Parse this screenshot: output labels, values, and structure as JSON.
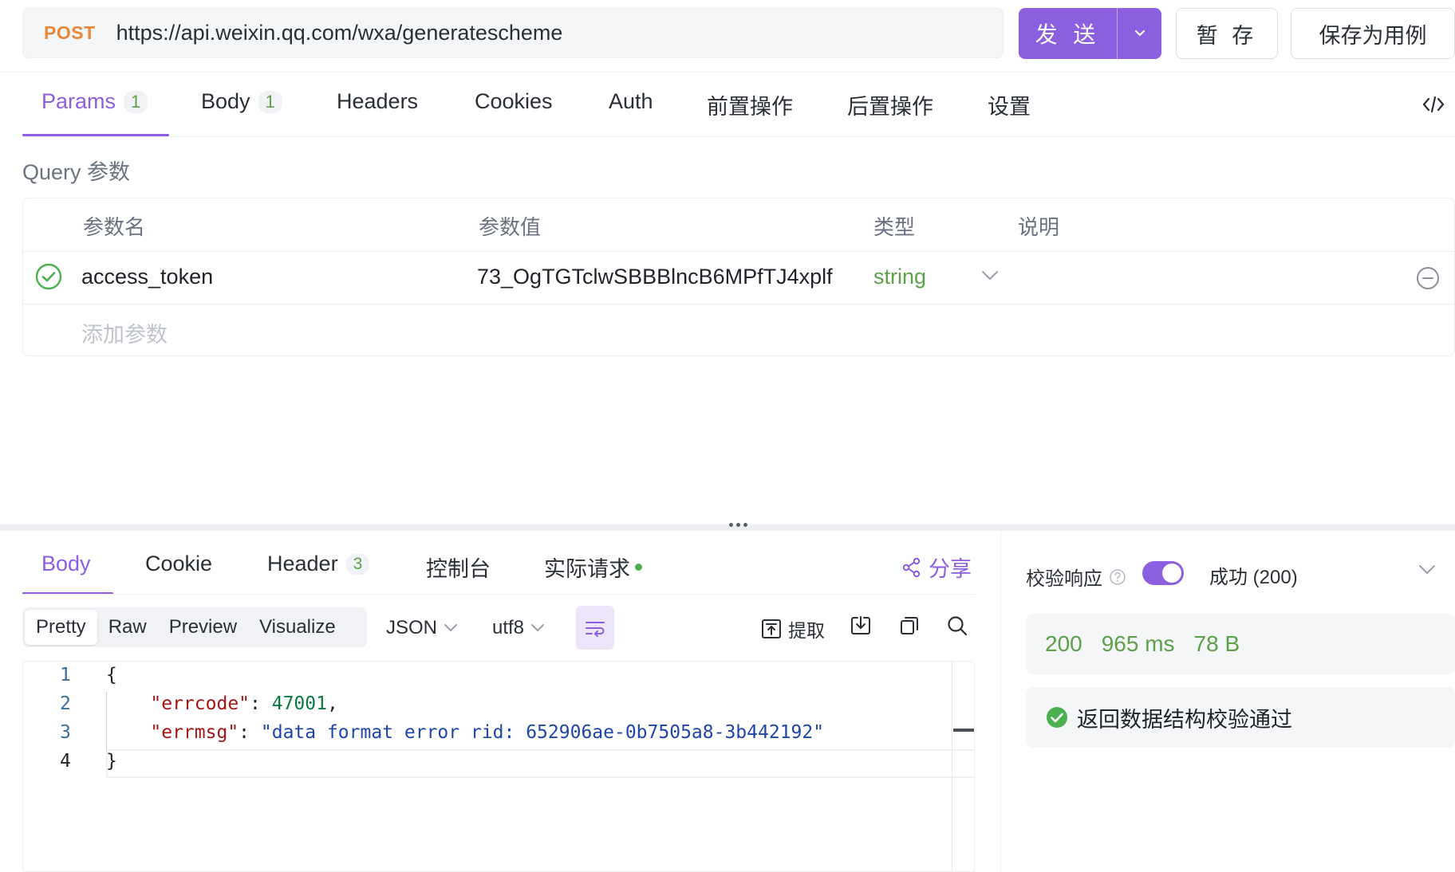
{
  "request": {
    "method": "POST",
    "url": "https://api.weixin.qq.com/wxa/generatescheme",
    "send_label": "发 送",
    "save_temp_label": "暂 存",
    "save_case_label": "保存为用例"
  },
  "request_tabs": [
    {
      "label": "Params",
      "badge": "1"
    },
    {
      "label": "Body",
      "badge": "1"
    },
    {
      "label": "Headers"
    },
    {
      "label": "Cookies"
    },
    {
      "label": "Auth"
    },
    {
      "label": "前置操作"
    },
    {
      "label": "后置操作"
    },
    {
      "label": "设置"
    }
  ],
  "query": {
    "title": "Query 参数",
    "columns": [
      "参数名",
      "参数值",
      "类型",
      "说明"
    ],
    "rows": [
      {
        "name": "access_token",
        "value": "73_OgTGTclwSBBBlncB6MPfTJ4xplf",
        "type": "string",
        "desc": "",
        "enabled": true
      }
    ],
    "add_placeholder": "添加参数"
  },
  "response_tabs": [
    {
      "label": "Body"
    },
    {
      "label": "Cookie"
    },
    {
      "label": "Header",
      "badge": "3"
    },
    {
      "label": "控制台"
    },
    {
      "label": "实际请求"
    }
  ],
  "share_label": "分享",
  "format_modes": [
    "Pretty",
    "Raw",
    "Preview",
    "Visualize"
  ],
  "format": "JSON",
  "encoding": "utf8",
  "extract_label": "提取",
  "code": {
    "line_numbers": [
      "1",
      "2",
      "3",
      "4"
    ],
    "open_brace": "{",
    "close_brace": "}",
    "errcode_key": "\"errcode\"",
    "errcode_value": "47001",
    "errmsg_key": "\"errmsg\"",
    "errmsg_value": "\"data format error rid: 652906ae-0b7505a8-3b442192\""
  },
  "validation": {
    "label": "校验响应",
    "enabled": true,
    "selected_status": "成功 (200)",
    "status_code": "200",
    "time": "965 ms",
    "size": "78 B",
    "result": "返回数据结构校验通过"
  },
  "colors": {
    "accent": "#8c5ee0",
    "method": "#e8883a",
    "success": "#5da04a"
  }
}
